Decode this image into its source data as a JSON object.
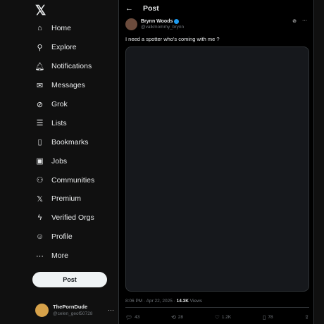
{
  "sidebar": {
    "logo": "𝕏",
    "items": [
      {
        "label": "Home",
        "icon": "home-icon",
        "glyph": "⌂"
      },
      {
        "label": "Explore",
        "icon": "search-icon",
        "glyph": "⚲"
      },
      {
        "label": "Notifications",
        "icon": "bell-icon",
        "glyph": "🔔︎"
      },
      {
        "label": "Messages",
        "icon": "envelope-icon",
        "glyph": "✉"
      },
      {
        "label": "Grok",
        "icon": "grok-icon",
        "glyph": "⊘"
      },
      {
        "label": "Lists",
        "icon": "list-icon",
        "glyph": "☰"
      },
      {
        "label": "Bookmarks",
        "icon": "bookmark-icon",
        "glyph": "▯"
      },
      {
        "label": "Jobs",
        "icon": "briefcase-icon",
        "glyph": "▣"
      },
      {
        "label": "Communities",
        "icon": "people-icon",
        "glyph": "⚇"
      },
      {
        "label": "Premium",
        "icon": "x-logo-icon",
        "glyph": "𝕏"
      },
      {
        "label": "Verified Orgs",
        "icon": "lightning-icon",
        "glyph": "ϟ"
      },
      {
        "label": "Profile",
        "icon": "person-icon",
        "glyph": "☺"
      },
      {
        "label": "More",
        "icon": "more-circle-icon",
        "glyph": "⋯"
      }
    ],
    "post_label": "Post",
    "account": {
      "name": "ThePornDude",
      "handle": "@celen_geof50728",
      "more": "···"
    }
  },
  "header": {
    "back": "←",
    "title": "Post"
  },
  "tweet": {
    "author_name": "Brynn Woods",
    "author_handle": "@valkmommy_brynn",
    "grok_glyph": "⊘",
    "more_glyph": "···",
    "text": "I need a spotter who's coming with me ?",
    "media_placeholder": "",
    "time": "8:06 PM · Apr 22, 2025 · ",
    "views_count": "14.3K",
    "views_label": " Views",
    "replies": "43",
    "reposts": "28",
    "likes": "1.2K",
    "bookmarks": "78"
  },
  "colors": {
    "accent": "#1d9bf0",
    "bg": "#000000",
    "sidebar_bg": "#101010"
  }
}
